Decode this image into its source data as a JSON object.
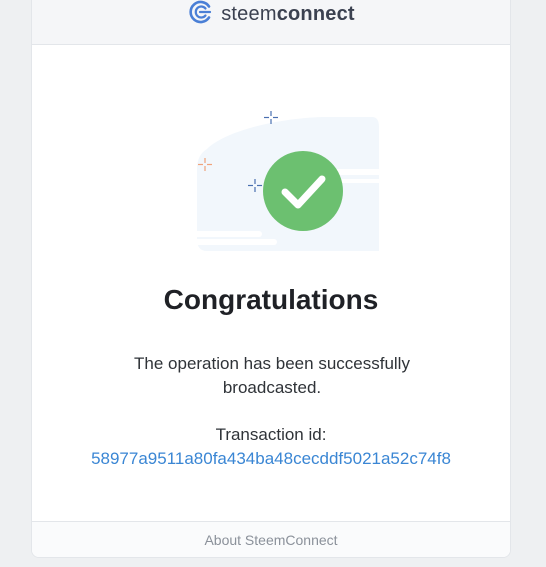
{
  "header": {
    "brand_light": "steem",
    "brand_bold": "connect"
  },
  "main": {
    "title": "Congratulations",
    "message": "The operation has been successfully broadcasted.",
    "transaction_label": "Transaction id:",
    "transaction_id": "58977a9511a80fa434ba48cecddf5021a52c74f8"
  },
  "footer": {
    "about_link": "About SteemConnect"
  },
  "icons": {
    "logo": "steemconnect-logo-icon",
    "success": "checkmark-icon"
  },
  "colors": {
    "success": "#6cc070",
    "link": "#3a86d4",
    "brand": "#4a7fd6"
  }
}
